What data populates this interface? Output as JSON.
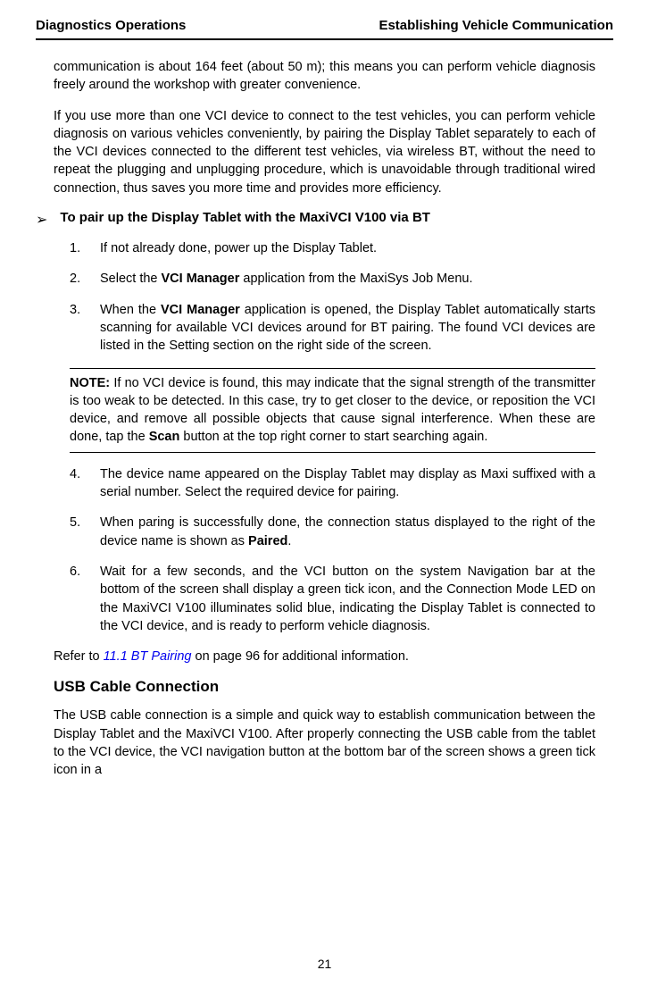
{
  "header": {
    "left": "Diagnostics Operations",
    "right": "Establishing Vehicle Communication"
  },
  "paragraphs": {
    "p1a": "communication is about 164 feet (about 50 m); this means you can perform vehicle diagnosis freely around the workshop with greater convenience.",
    "p2a": "If you use more than one VCI device to connect to the test vehicles, you can perform vehicle diagnosis on various vehicles conveniently, by pairing the Display Tablet separately to each of the VCI devices connected to the different test vehicles, via wireless BT, without the need to repeat the plugging and unplugging procedure, which is unavoidable through traditional wired connection, thus saves you more time and provides more efficiency."
  },
  "section": {
    "arrow": "➢",
    "title": "To pair up the Display Tablet with the MaxiVCI V100 via BT"
  },
  "list": {
    "n1": "1.",
    "t1": "If not already done, power up the Display Tablet.",
    "n2": "2.",
    "t2a": "Select the ",
    "t2b": "VCI Manager",
    "t2c": " application from the MaxiSys Job Menu.",
    "n3": "3.",
    "t3a": "When the ",
    "t3b": "VCI Manager",
    "t3c": " application is opened, the Display Tablet automatically starts scanning for available VCI devices around for BT pairing. The found VCI devices are listed in the Setting section on the right side of the screen.",
    "n4": "4.",
    "t4": "The device name appeared on the Display Tablet may display as Maxi suffixed with a serial number. Select the required device for pairing.",
    "n5": "5.",
    "t5a": "When paring is successfully done, the connection status displayed to the right of the device name is shown as ",
    "t5b": "Paired",
    "t5c": ".",
    "n6": "6.",
    "t6": "Wait for a few seconds, and the VCI button on the system Navigation bar at the bottom of the screen shall display a green tick icon, and the Connection Mode LED on the MaxiVCI V100 illuminates solid blue, indicating the Display Tablet is connected to the VCI device, and is ready to perform vehicle diagnosis."
  },
  "note": {
    "label": "NOTE:",
    "text": " If no VCI device is found, this may indicate that the signal strength of the transmitter is too weak to be detected. In this case, try to get closer to the device, or reposition the VCI device, and remove all possible objects that cause signal interference. When these are done, tap the ",
    "scan": "Scan",
    "text2": " button at the top right corner to start searching again."
  },
  "refer": {
    "a": "Refer to ",
    "link": "11.1 BT Pairing",
    "b": " on page 96 for additional information."
  },
  "subsection": {
    "title": "USB Cable Connection",
    "body": "The USB cable connection is a simple and quick way to establish communication between the Display Tablet and the MaxiVCI V100. After properly connecting the USB cable from the tablet to the VCI device, the VCI navigation button at the bottom bar of the screen shows a green tick icon in a"
  },
  "pageNumber": "21"
}
